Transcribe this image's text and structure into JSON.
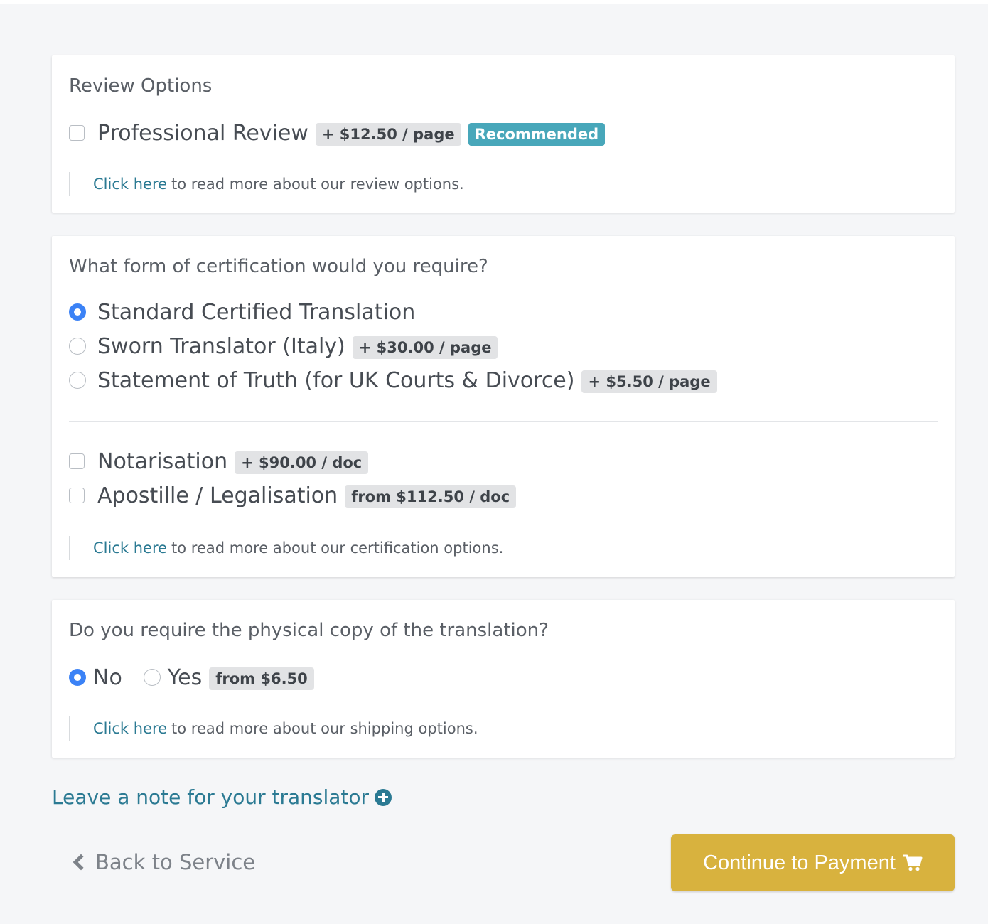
{
  "review": {
    "title": "Review Options",
    "options": [
      {
        "label": "Professional Review",
        "price": "+ $12.50 / page",
        "badge": "Recommended",
        "checked": false
      }
    ],
    "info_link": "Click here",
    "info_text": "to read more about our review options."
  },
  "certification": {
    "title": "What form of certification would you require?",
    "radio_options": [
      {
        "label": "Standard Certified Translation",
        "price": "",
        "checked": true
      },
      {
        "label": "Sworn Translator (Italy)",
        "price": "+ $30.00 / page",
        "checked": false
      },
      {
        "label": "Statement of Truth (for UK Courts & Divorce)",
        "price": "+ $5.50 / page",
        "checked": false
      }
    ],
    "addons": [
      {
        "label": "Notarisation",
        "price": "+ $90.00 / doc",
        "checked": false
      },
      {
        "label": "Apostille / Legalisation",
        "price": "from $112.50 / doc",
        "checked": false
      }
    ],
    "info_link": "Click here",
    "info_text": "to read more about our certification options."
  },
  "physical_copy": {
    "title": "Do you require the physical copy of the translation?",
    "options": [
      {
        "label": "No",
        "price": "",
        "checked": true
      },
      {
        "label": "Yes",
        "price": "from $6.50",
        "checked": false
      }
    ],
    "info_link": "Click here",
    "info_text": "to read more about our shipping options."
  },
  "note_link": "Leave a note for your translator",
  "back_label": "Back to Service",
  "continue_label": "Continue to Payment",
  "colors": {
    "accent_blue": "#3b82f6",
    "link": "#2b7a93",
    "recommended_badge": "#48a7ba",
    "continue_button": "#d8b23e"
  }
}
